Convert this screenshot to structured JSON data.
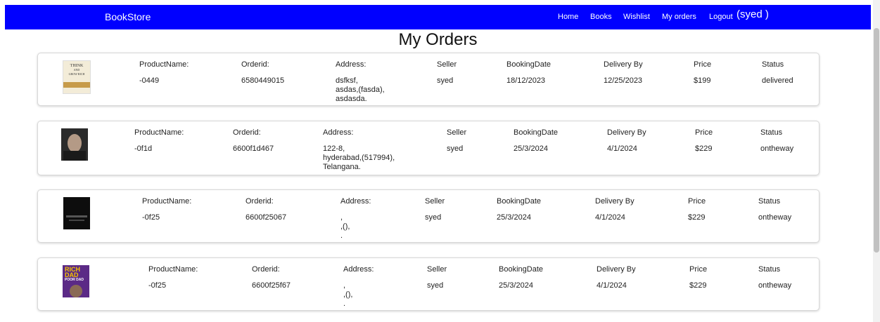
{
  "navbar": {
    "brand": "BookStore",
    "links": [
      "Home",
      "Books",
      "Wishlist",
      "My orders",
      "Logout"
    ],
    "user": "(syed )"
  },
  "page_title": "My Orders",
  "labels": {
    "product": "ProductName:",
    "orderid": "Orderid:",
    "address": "Address:",
    "seller": "Seller",
    "booking": "BookingDate",
    "delivery": "Delivery By",
    "price": "Price",
    "status": "Status"
  },
  "orders": [
    {
      "cover": "think-and-grow-rich-cover",
      "cover_lines": [
        "THINK",
        "AND",
        "GROW RICH"
      ],
      "product": "-0449",
      "orderid": "6580449015",
      "address": [
        "dsfksf,",
        "asdas,(fasda),",
        "asdasda."
      ],
      "seller": "syed",
      "booking": "18/12/2023",
      "delivery": "12/25/2023",
      "price": "$199",
      "status": "delivered"
    },
    {
      "cover": "portrait-book-cover",
      "product": "-0f1d",
      "orderid": "6600f1d467",
      "address": [
        "122-8,",
        "hyderabad,(517994),",
        "Telangana."
      ],
      "seller": "syed",
      "booking": "25/3/2024",
      "delivery": "4/1/2024",
      "price": "$229",
      "status": "ontheway"
    },
    {
      "cover": "dark-book-cover",
      "product": "-0f25",
      "orderid": "6600f25067",
      "address": [
        ",",
        ",(),",
        "."
      ],
      "seller": "syed",
      "booking": "25/3/2024",
      "delivery": "4/1/2024",
      "price": "$229",
      "status": "ontheway"
    },
    {
      "cover": "rich-dad-poor-dad-cover",
      "cover_lines": [
        "RICH",
        "DAD",
        "POOR DAD"
      ],
      "product": "-0f25",
      "orderid": "6600f25f67",
      "address": [
        ",",
        ",(),",
        "."
      ],
      "seller": "syed",
      "booking": "25/3/2024",
      "delivery": "4/1/2024",
      "price": "$229",
      "status": "ontheway"
    }
  ]
}
